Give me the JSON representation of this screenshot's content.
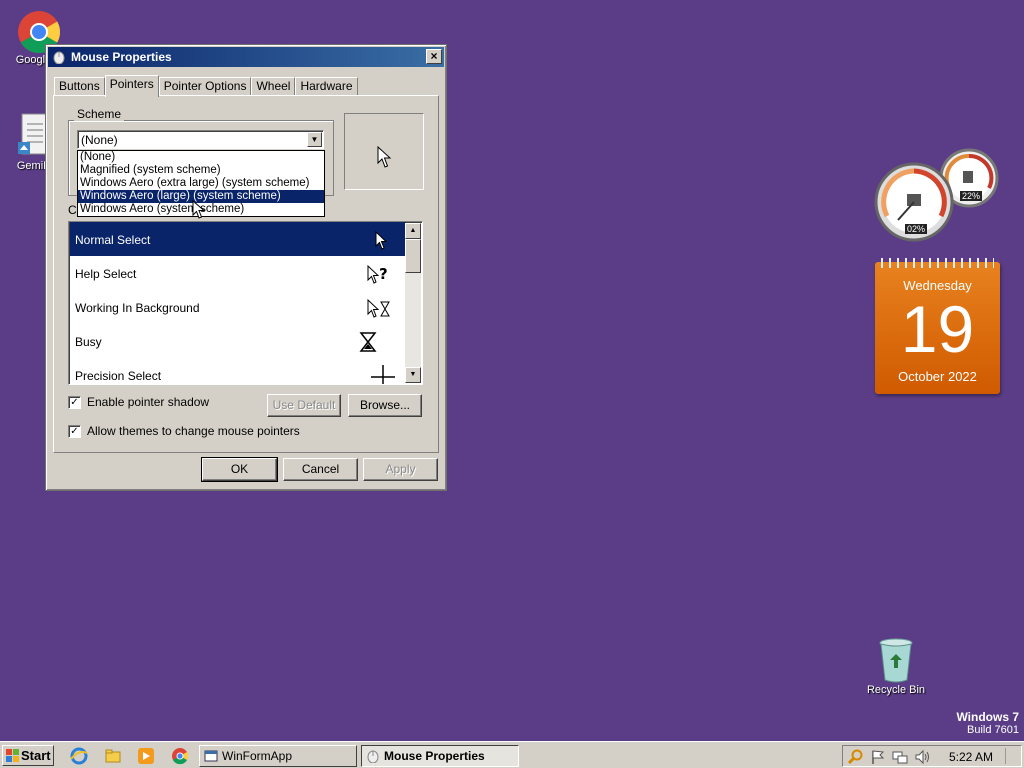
{
  "desktop": {
    "icons": [
      {
        "label": "Google C",
        "icon": "chrome-icon"
      },
      {
        "label": "GemiN",
        "icon": "document-icon"
      },
      {
        "label": "Recycle Bin",
        "icon": "recycle-bin-icon"
      }
    ],
    "os_name": "Windows 7",
    "os_build": "Build 7601"
  },
  "gadgets": {
    "cpu_meter": {
      "cpu": "02%",
      "memory": "22%"
    },
    "calendar": {
      "weekday": "Wednesday",
      "day": "19",
      "month_year": "October 2022"
    }
  },
  "dialog": {
    "title": "Mouse Properties",
    "close": "×",
    "tabs": [
      "Buttons",
      "Pointers",
      "Pointer Options",
      "Wheel",
      "Hardware"
    ],
    "active_tab": "Pointers",
    "scheme_label": "Scheme",
    "scheme_value": "(None)",
    "scheme_options": [
      "(None)",
      "Magnified (system scheme)",
      "Windows Aero (extra large) (system scheme)",
      "Windows Aero (large) (system scheme)",
      "Windows Aero (system scheme)"
    ],
    "scheme_highlighted": "Windows Aero (large) (system scheme)",
    "customize_label_visible": "C",
    "pointers": [
      {
        "name": "Normal Select",
        "icon": "arrow-cursor-icon",
        "selected": true
      },
      {
        "name": "Help Select",
        "icon": "help-cursor-icon",
        "selected": false
      },
      {
        "name": "Working In Background",
        "icon": "working-cursor-icon",
        "selected": false
      },
      {
        "name": "Busy",
        "icon": "hourglass-icon",
        "selected": false
      },
      {
        "name": "Precision Select",
        "icon": "crosshair-icon",
        "selected": false
      }
    ],
    "enable_shadow_label": "Enable pointer shadow",
    "enable_shadow_checked": true,
    "allow_themes_label": "Allow themes to change mouse pointers",
    "allow_themes_checked": true,
    "use_default_label": "Use Default",
    "browse_label": "Browse...",
    "ok_label": "OK",
    "cancel_label": "Cancel",
    "apply_label": "Apply"
  },
  "taskbar": {
    "start_label": "Start",
    "tasks": [
      {
        "label": "WinFormApp",
        "active": false
      },
      {
        "label": "Mouse Properties",
        "active": true
      }
    ],
    "clock": "5:22 AM"
  }
}
